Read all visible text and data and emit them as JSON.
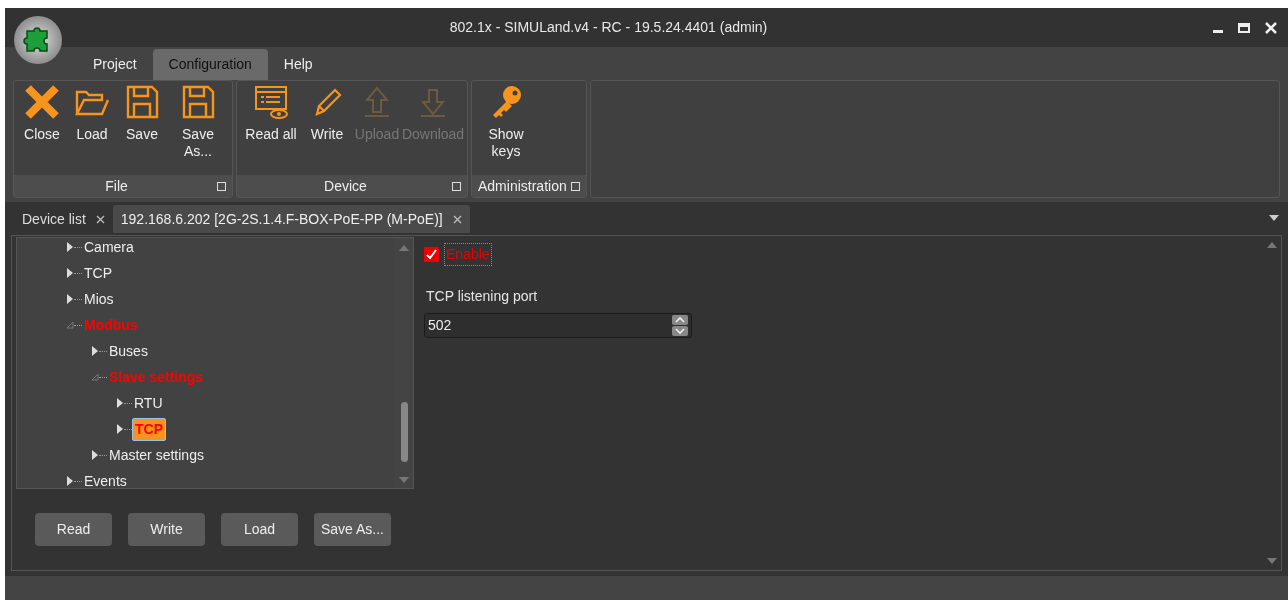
{
  "window": {
    "title": "802.1x - SIMULand.v4 - RC - 19.5.24.4401 (admin)"
  },
  "menu_tabs": [
    {
      "label": "Project",
      "selected": false
    },
    {
      "label": "Configuration",
      "selected": true
    },
    {
      "label": "Help",
      "selected": false
    }
  ],
  "ribbon_groups": [
    {
      "label": "File",
      "buttons": [
        {
          "label": "Close",
          "disabled": false
        },
        {
          "label": "Load",
          "disabled": false
        },
        {
          "label": "Save",
          "disabled": false
        },
        {
          "label": "Save As...",
          "disabled": false
        }
      ]
    },
    {
      "label": "Device",
      "buttons": [
        {
          "label": "Read all",
          "disabled": false
        },
        {
          "label": "Write",
          "disabled": false
        },
        {
          "label": "Upload",
          "disabled": true
        },
        {
          "label": "Download",
          "disabled": true
        }
      ]
    },
    {
      "label": "Administration",
      "buttons": [
        {
          "label": "Show keys",
          "disabled": false
        }
      ]
    }
  ],
  "doc_tabs": [
    {
      "label": "Device list",
      "selected": false
    },
    {
      "label": "192.168.6.202 [2G-2S.1.4.F-BOX-PoE-PP (M-PoE)]",
      "selected": true
    }
  ],
  "tree": [
    {
      "label": "Camera",
      "highlighted": false,
      "selected": false,
      "expanded": false
    },
    {
      "label": "TCP",
      "highlighted": false,
      "selected": false,
      "expanded": false
    },
    {
      "label": "Mios",
      "highlighted": false,
      "selected": false,
      "expanded": false
    },
    {
      "label": "Modbus",
      "highlighted": true,
      "selected": false,
      "expanded": true,
      "children": [
        {
          "label": "Buses",
          "highlighted": false,
          "selected": false,
          "expanded": false
        },
        {
          "label": "Slave settings",
          "highlighted": true,
          "selected": false,
          "expanded": true,
          "children": [
            {
              "label": "RTU",
              "highlighted": false,
              "selected": false,
              "expanded": false
            },
            {
              "label": "TCP",
              "highlighted": true,
              "selected": true,
              "expanded": false
            }
          ]
        },
        {
          "label": "Master settings",
          "highlighted": false,
          "selected": false,
          "expanded": false
        }
      ]
    },
    {
      "label": "Events",
      "highlighted": false,
      "selected": false,
      "expanded": false
    }
  ],
  "panel_buttons": [
    "Read",
    "Write",
    "Load",
    "Save As..."
  ],
  "settings": {
    "enable": {
      "label": "Enable",
      "checked": true
    },
    "port": {
      "label": "TCP listening port",
      "value": "502"
    }
  }
}
